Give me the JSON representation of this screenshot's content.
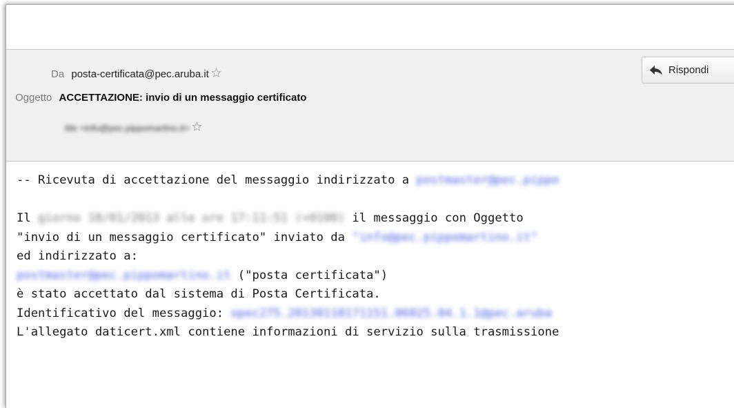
{
  "header": {
    "from_label": "Da",
    "from_value": "posta-certificata@pec.aruba.it",
    "subject_label": "Oggetto",
    "subject_value": "ACCETTAZIONE: invio di un messaggio certificato",
    "to_value_blurred": "Me <info@pec.pippomartino.it>",
    "reply_label": "Rispondi"
  },
  "body": {
    "line1_prefix": "-- Ricevuta di accettazione del messaggio indirizzato a ",
    "line1_link": "postmaster@pec.pippo",
    "line3_prefix": "Il ",
    "line3_blurred": "giorno 18/01/2013 alle ore 17:11:51 (+0100)",
    "line3_suffix": " il messaggio con Oggetto",
    "line4_prefix": "\"invio di un messaggio certificato\" inviato da ",
    "line4_link": "\"info@pec.pippomartino.it\"",
    "line5": "ed indirizzato a:",
    "line6_link": "postmaster@pec.pippomartino.it",
    "line6_suffix": " (\"posta certificata\")",
    "line7": "è stato accettato dal sistema di Posta Certificata.",
    "line8_prefix": "Identificativo del messaggio: ",
    "line8_link": "opec275.20130118171151.06025.04.1.1@pec.aruba",
    "line9": "L'allegato daticert.xml contiene informazioni di servizio sulla trasmissione"
  },
  "icons": {
    "star": "star-outline-icon",
    "reply": "reply-arrow-icon"
  },
  "colors": {
    "header_bg": "#f0f0f0",
    "link": "#4c5fe0",
    "label": "#7d7d7d"
  }
}
